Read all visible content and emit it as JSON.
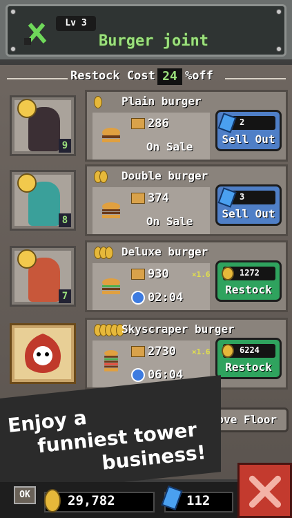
{
  "header": {
    "level": "Lv 3",
    "title": "Burger joint"
  },
  "restock": {
    "label": "Restock Cost",
    "percent": "24",
    "suffix": "%off"
  },
  "items": [
    {
      "name": "Plain burger",
      "stock": "286",
      "status": "On Sale",
      "action_value": "2",
      "action_label": "Sell Out",
      "staff_level": "9",
      "coins": 1
    },
    {
      "name": "Double burger",
      "stock": "374",
      "status": "On Sale",
      "action_value": "3",
      "action_label": "Sell Out",
      "staff_level": "8",
      "coins": 2
    },
    {
      "name": "Deluxe burger",
      "stock": "930",
      "multiplier": "×1.6",
      "timer": "02:04",
      "action_value": "1272",
      "action_label": "Restock",
      "staff_level": "7",
      "coins": 3
    },
    {
      "name": "Skyscraper burger",
      "stock": "2730",
      "multiplier": "×1.6",
      "timer": "06:04",
      "action_value": "6224",
      "action_label": "Restock",
      "coins": 5
    }
  ],
  "promo": {
    "line1": "Enjoy a",
    "line2": "funniest tower",
    "line3": "business!"
  },
  "remove_floor_label": "move Floor",
  "bottom": {
    "ok_label": "OK",
    "money": "29,782",
    "gems": "112"
  },
  "colors": {
    "accent_green": "#9be07c",
    "sell_blue": "#4f7fc7",
    "restock_green": "#2fa35e",
    "close_red": "#c33a2e"
  }
}
